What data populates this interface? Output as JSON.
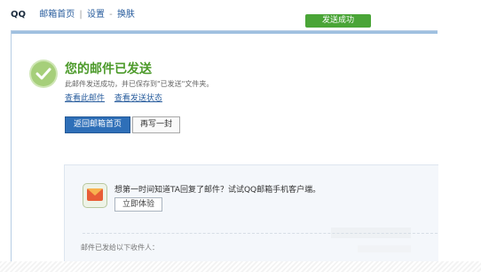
{
  "topbar": {
    "brand": "QQ",
    "nav_items": [
      "邮箱首页",
      "设置",
      "换肤"
    ]
  },
  "toast": "发送成功",
  "status": {
    "title": "您的邮件已发送",
    "description": "此邮件发送成功，并已保存到\"已发送\"文件夹。",
    "links": [
      "查看此邮件",
      "查看发送状态"
    ]
  },
  "buttons": {
    "back_home": "返回邮箱首页",
    "rewrite": "再写一封"
  },
  "promo": {
    "text": "想第一时间知道TA回复了邮件？试试QQ邮箱手机客户端。",
    "try_label": "立即体验",
    "recipients_label": "邮件已发给以下收件人："
  },
  "colors": {
    "accent": "#2e6fb8",
    "success": "#4c9a2a",
    "toast": "#4aa537"
  }
}
